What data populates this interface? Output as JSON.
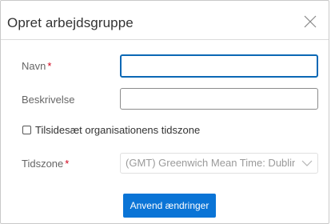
{
  "dialog": {
    "title": "Opret arbejdsgruppe"
  },
  "form": {
    "name_label": "Navn",
    "name_required": "*",
    "name_value": "",
    "description_label": "Beskrivelse",
    "description_value": "",
    "override_tz_label": "Tilsidesæt organisationens tidszone",
    "override_tz_checked": false,
    "timezone_label": "Tidszone",
    "timezone_required": "*",
    "timezone_value": "(GMT) Greenwich Mean Time: Dublin, Edinb"
  },
  "actions": {
    "apply_label": "Anvend ændringer"
  },
  "colors": {
    "accent": "#0a74d6",
    "required": "#d0021b",
    "focus_border": "#0b68b5"
  },
  "icons": {
    "close": "close-icon",
    "chevron": "chevron-down-icon"
  }
}
